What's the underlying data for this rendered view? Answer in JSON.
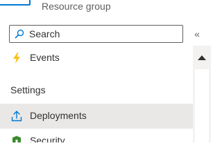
{
  "header": {
    "subtitle": "Resource group",
    "icon": "resource-group-icon"
  },
  "search": {
    "placeholder": "Search",
    "icon": "search-icon"
  },
  "collapse": {
    "label": "«"
  },
  "nav": {
    "items_before": [
      {
        "label": "Events",
        "icon": "lightning-icon"
      }
    ],
    "section_title": "Settings",
    "items_after": [
      {
        "label": "Deployments",
        "icon": "upload-icon",
        "selected": true
      },
      {
        "label": "Security",
        "icon": "shield-icon"
      }
    ]
  },
  "colors": {
    "accent": "#0078d4",
    "selected_bg": "#e9e8e7",
    "events_icon": "#f8c21c",
    "security_icon": "#3a8a2c"
  }
}
